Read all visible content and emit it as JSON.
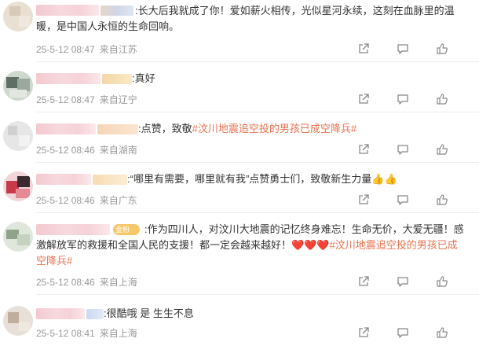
{
  "comments": [
    {
      "text": ":长大后我就成了你！爱如薪火相传，光似星河永续，这刻在血脉里的温暖，是中国人永恒的生命回响。",
      "time": "25-5-12 08:47",
      "location": "来自江苏"
    },
    {
      "text": ":真好",
      "time": "25-5-12 08:47",
      "location": "来自辽宁"
    },
    {
      "text_prefix": ":点赞，致敬",
      "hashtag": "#汶川地震追空投的男孩已成空降兵#",
      "time": "25-5-12 08:46",
      "location": "来自湖南"
    },
    {
      "text": ":“哪里有需要，哪里就有我”点赞勇士们，致敬新生力量",
      "emoji": "👍👍",
      "time": "25-5-12 08:46",
      "location": "来自广东"
    },
    {
      "badge": "金粉",
      "text": ":作为四川人，对汶川大地震的记忆终身难忘！生命无价，大爱无疆！感激解放军的救援和全国人民的支援！都一定会越来越好！",
      "emoji": "❤️❤️❤️",
      "hashtag": "#汶川地震追空投的男孩已成空降兵#",
      "time": "25-5-12 08:46",
      "location": "来自上海"
    },
    {
      "text": ":很酷哦 是 生生不息",
      "time": "25-5-12 08:41",
      "location": "来自上海"
    }
  ],
  "icons": [
    "share-icon",
    "comment-icon",
    "like-icon"
  ],
  "colors": {
    "hashtag": "#eb7350",
    "meta": "#999999",
    "icon": "#888888"
  }
}
